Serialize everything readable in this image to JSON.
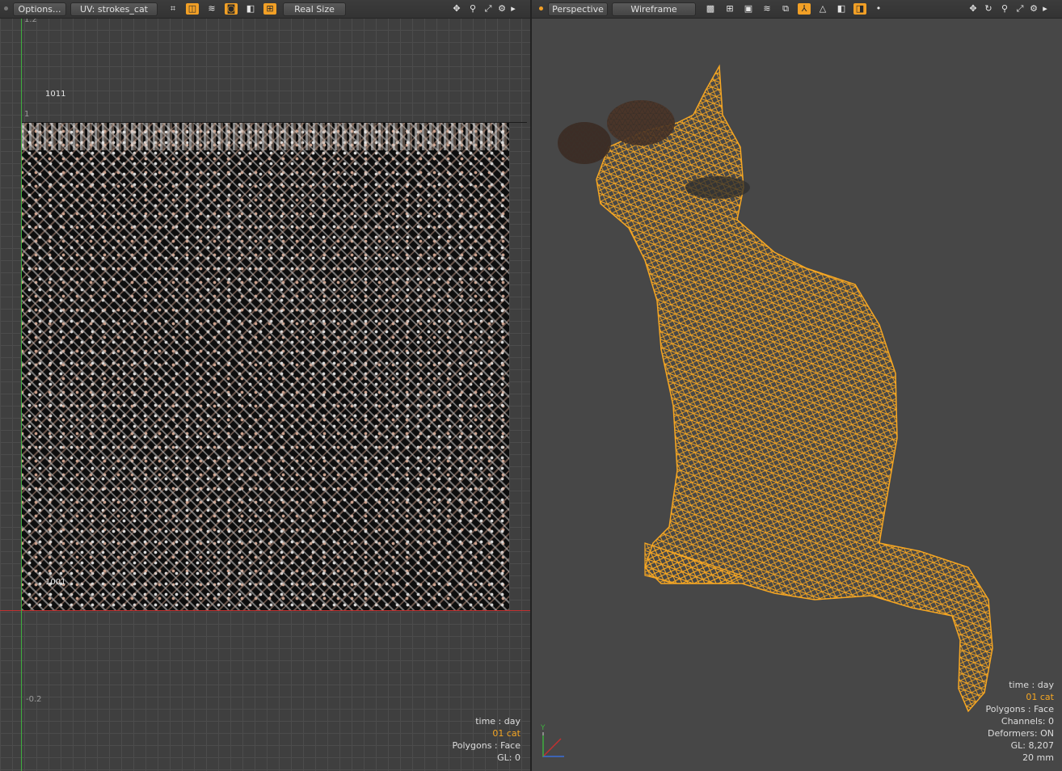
{
  "uv_panel": {
    "toolbar": {
      "options_label": "Options...",
      "uv_map_label": "UV: strokes_cat",
      "real_size_label": "Real Size"
    },
    "tile_labels": {
      "top": "1011",
      "bottom": "1001"
    },
    "tick_labels": {
      "one": "1",
      "neg": "-0.2",
      "top_cut": "1.2"
    },
    "hud": {
      "time": "time : day",
      "item": "01 cat",
      "polygons": "Polygons : Face",
      "gl": "GL: 0"
    }
  },
  "viewport_panel": {
    "toolbar": {
      "view_label": "Perspective",
      "shading_label": "Wireframe"
    },
    "hud": {
      "time": "time : day",
      "item": "01 cat",
      "polygons": "Polygons : Face",
      "channels": "Channels: 0",
      "deformers": "Deformers: ON",
      "gl": "GL: 8,207",
      "lens": "20 mm"
    },
    "gizmo_axis_label": "Y"
  },
  "colors": {
    "accent": "#f2a026",
    "wireframe": "#f5a623",
    "x_axis": "#c23030",
    "y_axis": "#3fae3f"
  },
  "icons": [
    "move-icon",
    "zoom-icon",
    "fit-icon",
    "gear-icon",
    "expand-arrow-icon",
    "rotate-icon"
  ]
}
